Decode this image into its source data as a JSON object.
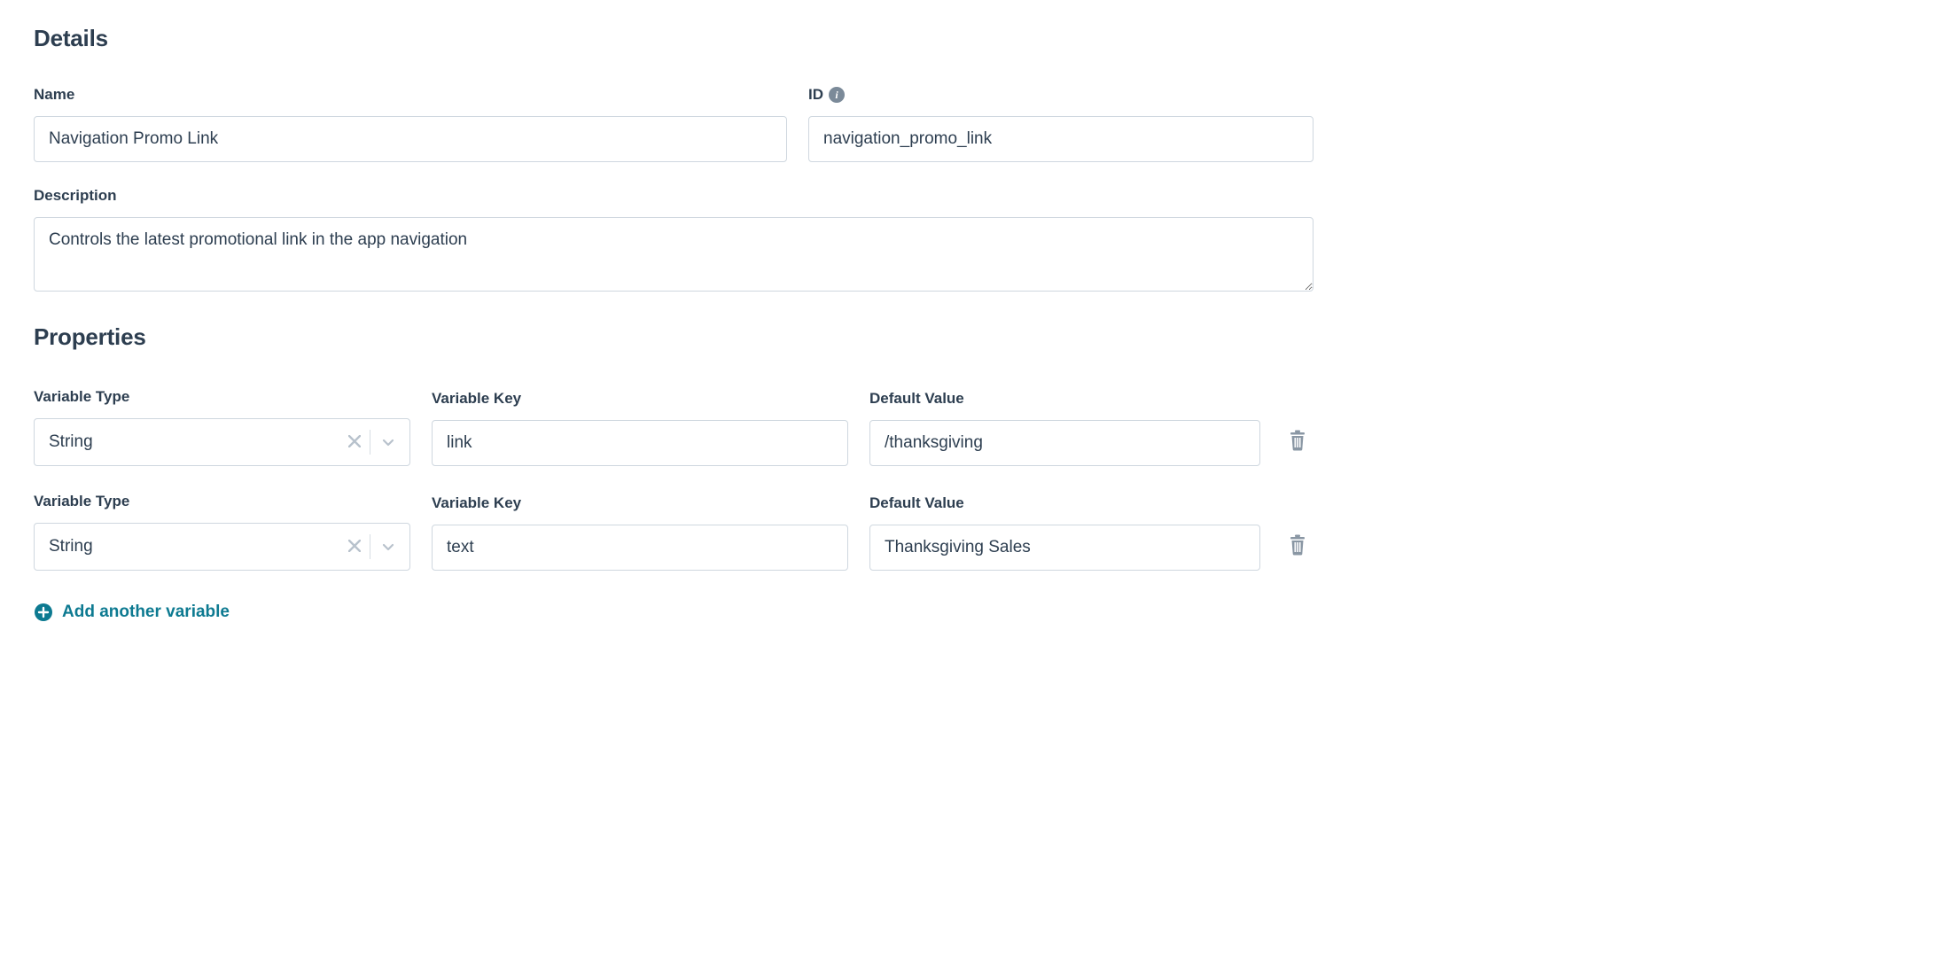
{
  "sections": {
    "details": "Details",
    "properties": "Properties"
  },
  "labels": {
    "name": "Name",
    "id": "ID",
    "description": "Description",
    "variable_type": "Variable Type",
    "variable_key": "Variable Key",
    "default_value": "Default Value"
  },
  "details": {
    "name": "Navigation Promo Link",
    "id": "navigation_promo_link",
    "description": "Controls the latest promotional link in the app navigation"
  },
  "properties": [
    {
      "type": "String",
      "key": "link",
      "default": "/thanksgiving"
    },
    {
      "type": "String",
      "key": "text",
      "default": "Thanksgiving Sales"
    }
  ],
  "actions": {
    "add_variable": "Add another variable"
  },
  "icons": {
    "info": "i"
  }
}
